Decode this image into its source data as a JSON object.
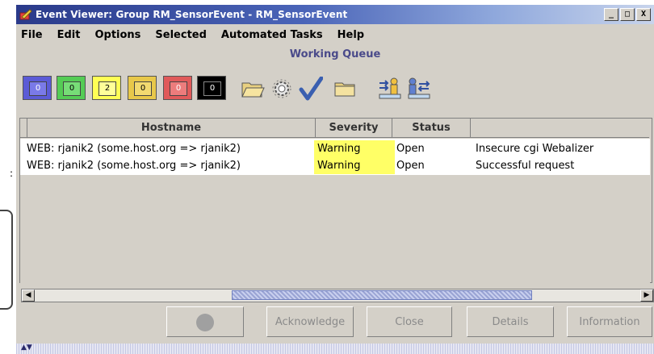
{
  "window": {
    "title": "Event Viewer: Group RM_SensorEvent - RM_SensorEvent",
    "controls": {
      "minimize": "_",
      "maximize": "□",
      "close": "X"
    }
  },
  "menu": [
    "File",
    "Edit",
    "Options",
    "Selected",
    "Automated Tasks",
    "Help"
  ],
  "queue_label": "Working Queue",
  "severity_filters": [
    {
      "count": "0",
      "color": "#5b5bd6"
    },
    {
      "count": "0",
      "color": "#55cc55"
    },
    {
      "count": "2",
      "color": "#ffff55"
    },
    {
      "count": "0",
      "color": "#e8c84a"
    },
    {
      "count": "0",
      "color": "#e05a5a"
    },
    {
      "count": "0",
      "color": "#000000"
    }
  ],
  "toolbar_icons": [
    "folder-open-icon",
    "gear-icon",
    "checkmark-icon",
    "folder-icon",
    "person-arrows-icon",
    "person-transfer-icon"
  ],
  "table": {
    "columns": [
      "Hostname",
      "Severity",
      "Status",
      ""
    ],
    "rows": [
      {
        "hostname": "WEB: rjanik2 (some.host.org => rjanik2)",
        "severity": "Warning",
        "status": "Open",
        "description": "Insecure cgi Webalizer"
      },
      {
        "hostname": "WEB: rjanik2 (some.host.org => rjanik2)",
        "severity": "Warning",
        "status": "Open",
        "description": "Successful request"
      }
    ]
  },
  "scroll": {
    "left_arrow": "◀",
    "right_arrow": "▶"
  },
  "actions": {
    "acknowledge": "Acknowledge",
    "close": "Close",
    "details": "Details",
    "information": "Information"
  },
  "margin_text": ":"
}
